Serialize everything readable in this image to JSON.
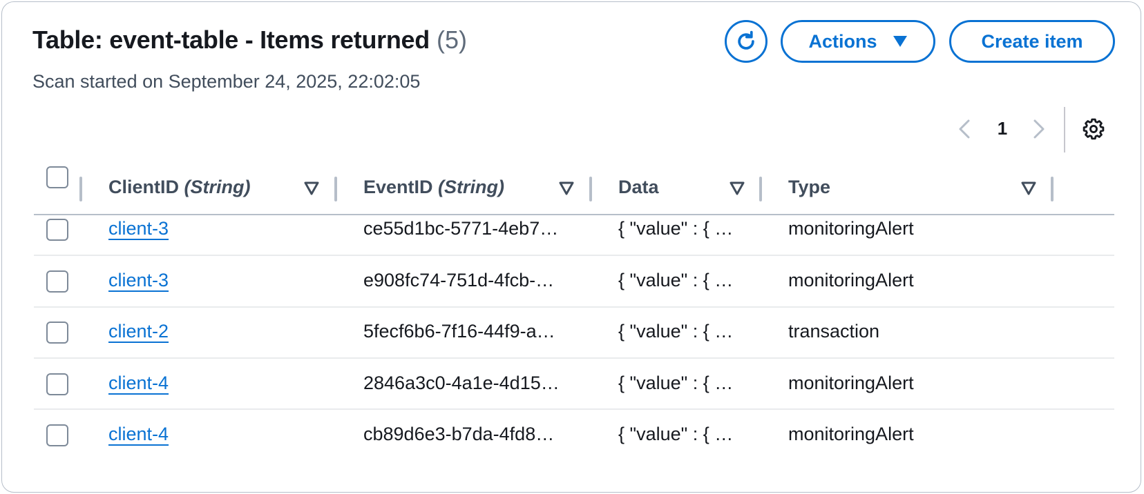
{
  "header": {
    "title": "Table: event-table - Items returned",
    "count": "(5)",
    "subtitle": "Scan started on September 24, 2025, 22:02:05"
  },
  "toolbar": {
    "actions_label": "Actions",
    "create_label": "Create item"
  },
  "pagination": {
    "current_page": "1"
  },
  "columns": [
    {
      "name": "ClientID",
      "type": "(String)"
    },
    {
      "name": "EventID",
      "type": "(String)"
    },
    {
      "name": "Data",
      "type": ""
    },
    {
      "name": "Type",
      "type": ""
    }
  ],
  "rows": [
    {
      "client_id": "client-3",
      "event_id": "ce55d1bc-5771-4eb7…",
      "data": "{ \"value\" : { …",
      "type": "monitoringAlert"
    },
    {
      "client_id": "client-3",
      "event_id": "e908fc74-751d-4fcb-…",
      "data": "{ \"value\" : { …",
      "type": "monitoringAlert"
    },
    {
      "client_id": "client-2",
      "event_id": "5fecf6b6-7f16-44f9-a…",
      "data": "{ \"value\" : { …",
      "type": "transaction"
    },
    {
      "client_id": "client-4",
      "event_id": "2846a3c0-4a1e-4d15…",
      "data": "{ \"value\" : { …",
      "type": "monitoringAlert"
    },
    {
      "client_id": "client-4",
      "event_id": "cb89d6e3-b7da-4fd8…",
      "data": "{ \"value\" : { …",
      "type": "monitoringAlert"
    }
  ],
  "colors": {
    "accent": "#0972d3",
    "text": "#16191f",
    "muted": "#5f6b7a",
    "border": "#b6bec9"
  }
}
